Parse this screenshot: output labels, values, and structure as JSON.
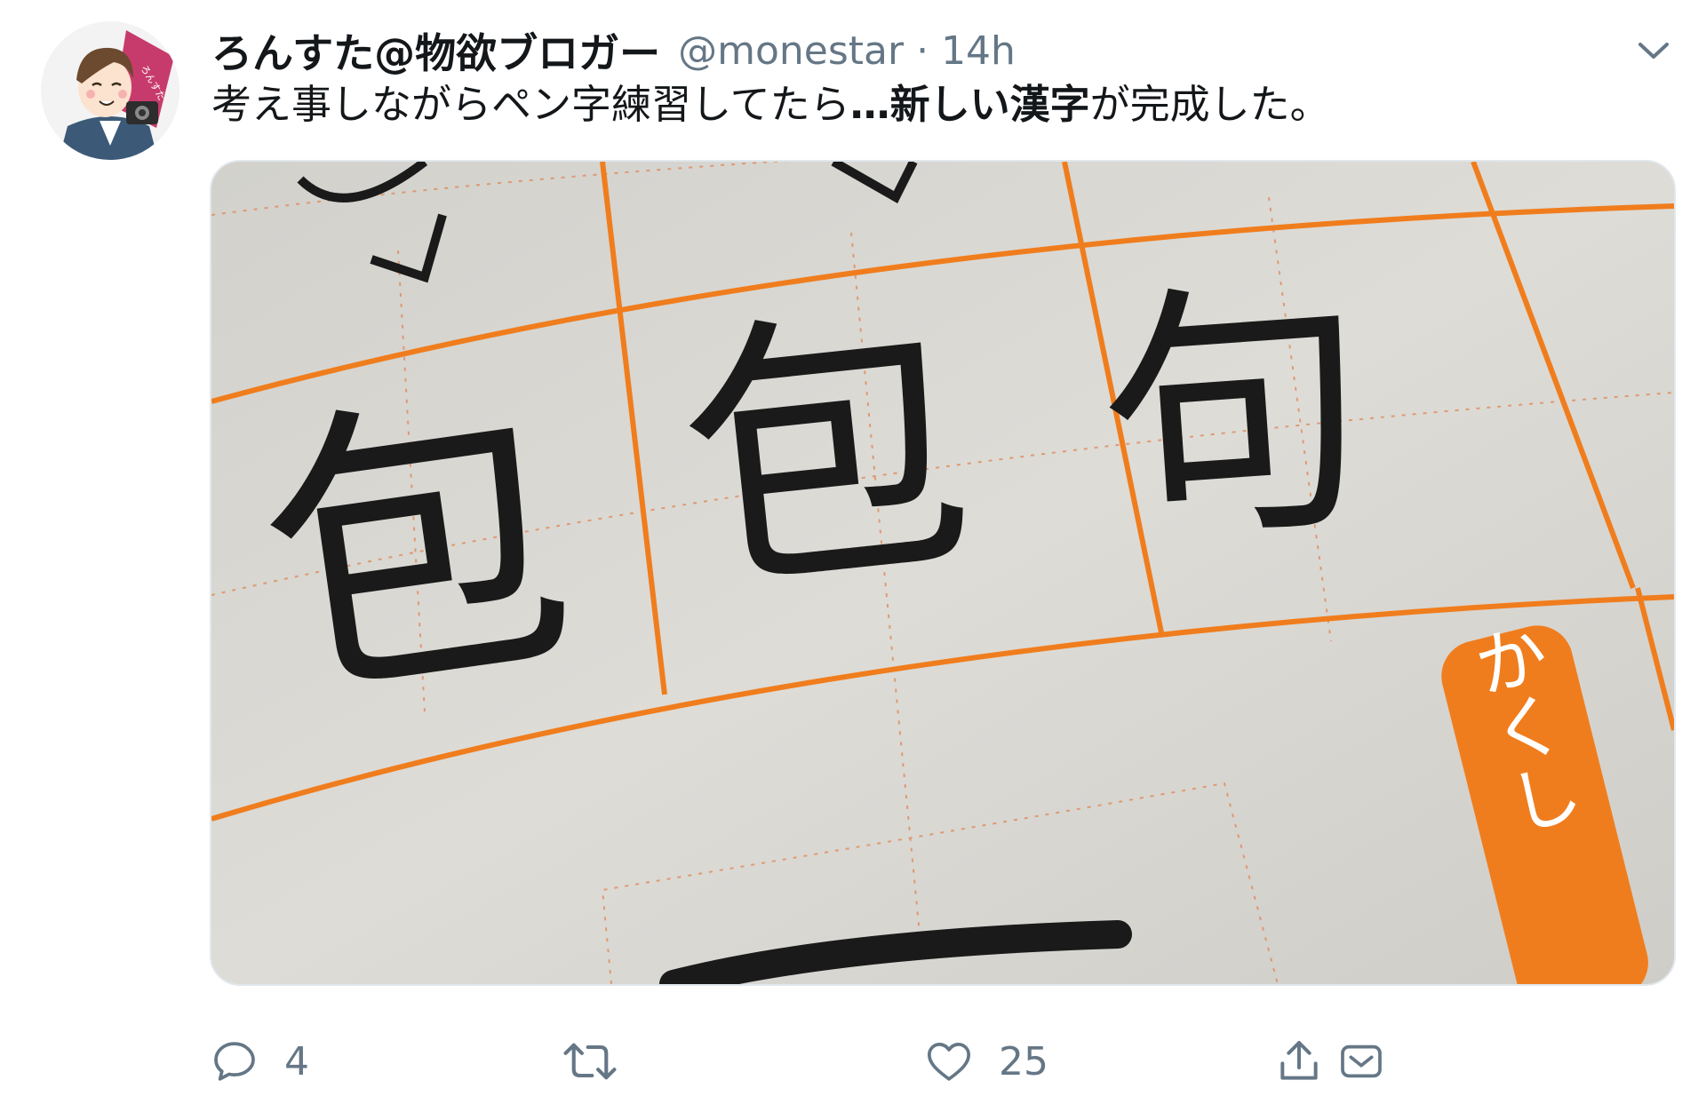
{
  "tweet": {
    "author": {
      "display_name": "ろんすた@物欲ブロガー",
      "handle": "@monestar",
      "separator": "·",
      "time": "14h",
      "avatar_badge_text": "ろんすた"
    },
    "text": {
      "part1": "考え事しながらペン字練習してたら",
      "part2_bold": "…新しい漢字",
      "part3": "が完成した。"
    },
    "media": {
      "kanji": [
        "包",
        "包",
        "句"
      ],
      "sticker_label": "かくし",
      "accent_color": "#f07d1d"
    },
    "actions": {
      "reply": {
        "icon": "reply-icon",
        "count": "4"
      },
      "retweet": {
        "icon": "retweet-icon",
        "count": ""
      },
      "like": {
        "icon": "heart-icon",
        "count": "25"
      },
      "share": {
        "icon": "share-icon"
      },
      "dm": {
        "icon": "dm-icon"
      }
    },
    "colors": {
      "text": "#14171a",
      "secondary": "#657786",
      "border": "#e1e8ed"
    }
  }
}
